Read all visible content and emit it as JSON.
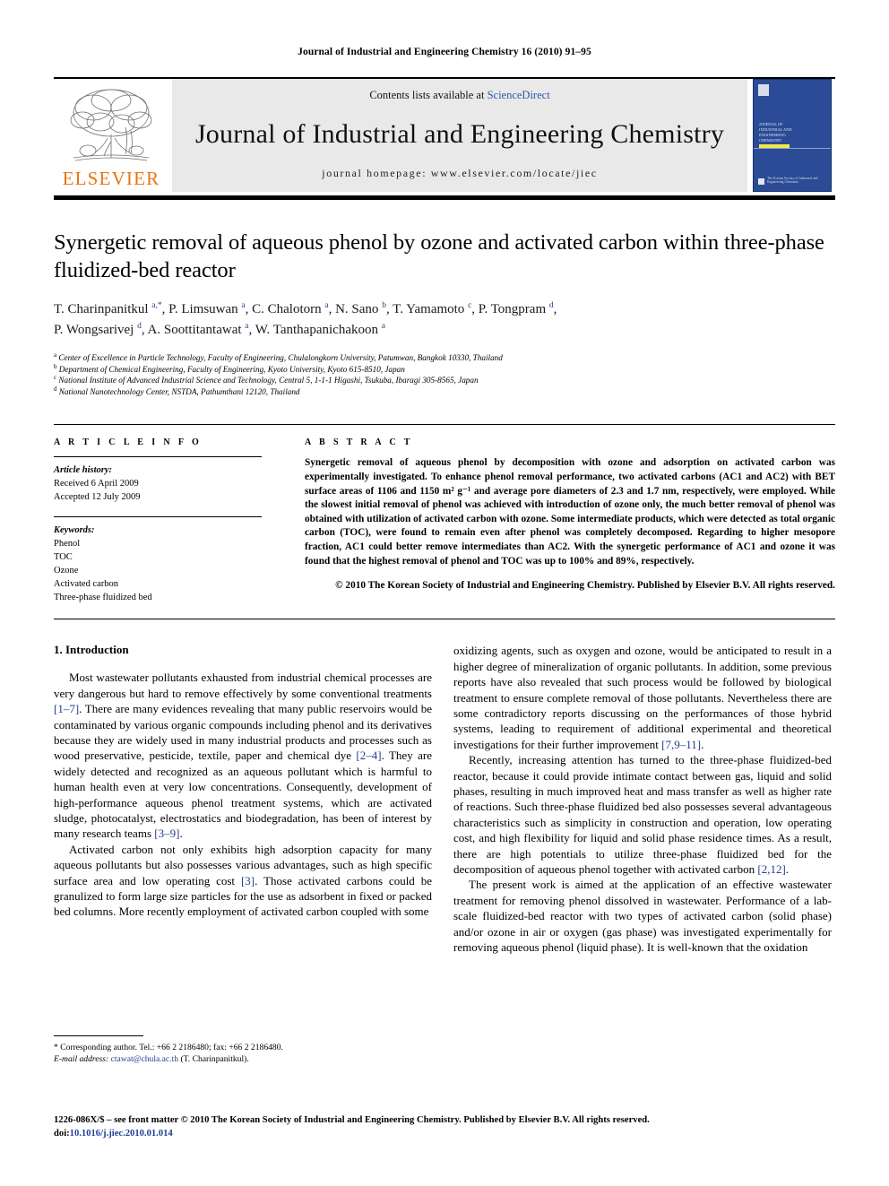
{
  "running_head": "Journal of Industrial and Engineering Chemistry 16 (2010) 91–95",
  "masthead": {
    "publisher_name": "ELSEVIER",
    "contents_prefix": "Contents lists available at ",
    "contents_link": "ScienceDirect",
    "journal_title": "Journal of Industrial and Engineering Chemistry",
    "homepage": "journal homepage: www.elsevier.com/locate/jiec",
    "cover": {
      "line1": "JOURNAL OF",
      "line2": "INDUSTRIAL AND",
      "line3": "ENGINEERING",
      "line4": "CHEMISTRY",
      "bottom": "The Korean Society of Industrial and Engineering Chemistry"
    }
  },
  "article": {
    "title": "Synergetic removal of aqueous phenol by ozone and activated carbon within three-phase fluidized-bed reactor",
    "authors_line1": "T. Charinpanitkul <sup>a,*</sup>, P. Limsuwan <sup>a</sup>, C. Chalotorn <sup>a</sup>, N. Sano <sup>b</sup>, T. Yamamoto <sup>c</sup>, P. Tongpram <sup>d</sup>,",
    "authors_line2": "P. Wongsarivej <sup>d</sup>, A. Soottitantawat <sup>a</sup>, W. Tanthapanichakoon <sup>a</sup>",
    "affiliations": [
      "Center of Excellence in Particle Technology, Faculty of Engineering, Chulalongkorn University, Patumwan, Bangkok 10330, Thailand",
      "Department of Chemical Engineering, Faculty of Engineering, Kyoto University, Kyoto 615-8510, Japan",
      "National Institute of Advanced Industrial Science and Technology, Central 5, 1-1-1 Higashi, Tsukuba, Ibaragi 305-8565, Japan",
      "National Nanotechnology Center, NSTDA, Pathumthani 12120, Thailand"
    ],
    "affiliation_marks": [
      "a",
      "b",
      "c",
      "d"
    ]
  },
  "article_info": {
    "heading": "A R T I C L E  I N F O",
    "history_label": "Article history:",
    "received": "Received 6 April 2009",
    "accepted": "Accepted 12 July 2009",
    "keywords_label": "Keywords:",
    "keywords": [
      "Phenol",
      "TOC",
      "Ozone",
      "Activated carbon",
      "Three-phase fluidized bed"
    ]
  },
  "abstract": {
    "heading": "A B S T R A C T",
    "text": "Synergetic removal of aqueous phenol by decomposition with ozone and adsorption on activated carbon was experimentally investigated. To enhance phenol removal performance, two activated carbons (AC1 and AC2) with BET surface areas of 1106 and 1150 m² g⁻¹ and average pore diameters of 2.3 and 1.7 nm, respectively, were employed. While the slowest initial removal of phenol was achieved with introduction of ozone only, the much better removal of phenol was obtained with utilization of activated carbon with ozone. Some intermediate products, which were detected as total organic carbon (TOC), were found to remain even after phenol was completely decomposed. Regarding to higher mesopore fraction, AC1 could better remove intermediates than AC2. With the synergetic performance of AC1 and ozone it was found that the highest removal of phenol and TOC was up to 100% and 89%, respectively.",
    "copyright": "© 2010 The Korean Society of Industrial and Engineering Chemistry. Published by Elsevier B.V. All rights reserved."
  },
  "body": {
    "section_heading": "1. Introduction",
    "left_paragraphs": [
      "Most wastewater pollutants exhausted from industrial chemical processes are very dangerous but hard to remove effectively by some conventional treatments [1–7]. There are many evidences revealing that many public reservoirs would be contaminated by various organic compounds including phenol and its derivatives because they are widely used in many industrial products and processes such as wood preservative, pesticide, textile, paper and chemical dye [2–4]. They are widely detected and recognized as an aqueous pollutant which is harmful to human health even at very low concentrations. Consequently, development of high-performance aqueous phenol treatment systems, which are activated sludge, photocatalyst, electrostatics and biodegradation, has been of interest by many research teams [3–9].",
      "Activated carbon not only exhibits high adsorption capacity for many aqueous pollutants but also possesses various advantages, such as high specific surface area and low operating cost [3]. Those activated carbons could be granulized to form large size particles for the use as adsorbent in fixed or packed bed columns. More recently employment of activated carbon coupled with some"
    ],
    "right_paragraphs": [
      "oxidizing agents, such as oxygen and ozone, would be anticipated to result in a higher degree of mineralization of organic pollutants. In addition, some previous reports have also revealed that such process would be followed by biological treatment to ensure complete removal of those pollutants. Nevertheless there are some contradictory reports discussing on the performances of those hybrid systems, leading to requirement of additional experimental and theoretical investigations for their further improvement [7,9–11].",
      "Recently, increasing attention has turned to the three-phase fluidized-bed reactor, because it could provide intimate contact between gas, liquid and solid phases, resulting in much improved heat and mass transfer as well as higher rate of reactions. Such three-phase fluidized bed also possesses several advantageous characteristics such as simplicity in construction and operation, low operating cost, and high flexibility for liquid and solid phase residence times. As a result, there are high potentials to utilize three-phase fluidized bed for the decomposition of aqueous phenol together with activated carbon [2,12].",
      "The present work is aimed at the application of an effective wastewater treatment for removing phenol dissolved in wastewater. Performance of a lab-scale fluidized-bed reactor with two types of activated carbon (solid phase) and/or ozone in air or oxygen (gas phase) was investigated experimentally for removing aqueous phenol (liquid phase). It is well-known that the oxidation"
    ]
  },
  "footnote": {
    "corresponding": "* Corresponding author. Tel.: +66 2 2186480; fax: +66 2 2186480.",
    "email_label": "E-mail address:",
    "email": "ctawat@chula.ac.th",
    "email_suffix": "(T. Charinpanitkul)."
  },
  "footer": {
    "issn_line": "1226-086X/$ – see front matter © 2010 The Korean Society of Industrial and Engineering Chemistry. Published by Elsevier B.V. All rights reserved.",
    "doi_prefix": "doi:",
    "doi": "10.1016/j.jiec.2010.01.014"
  },
  "colors": {
    "link_blue": "#2b57a8",
    "reference_blue": "#1f3f8f",
    "elsevier_orange": "#E87511",
    "cover_blue": "#2b4b96",
    "band_gray": "#e9e9e9"
  }
}
